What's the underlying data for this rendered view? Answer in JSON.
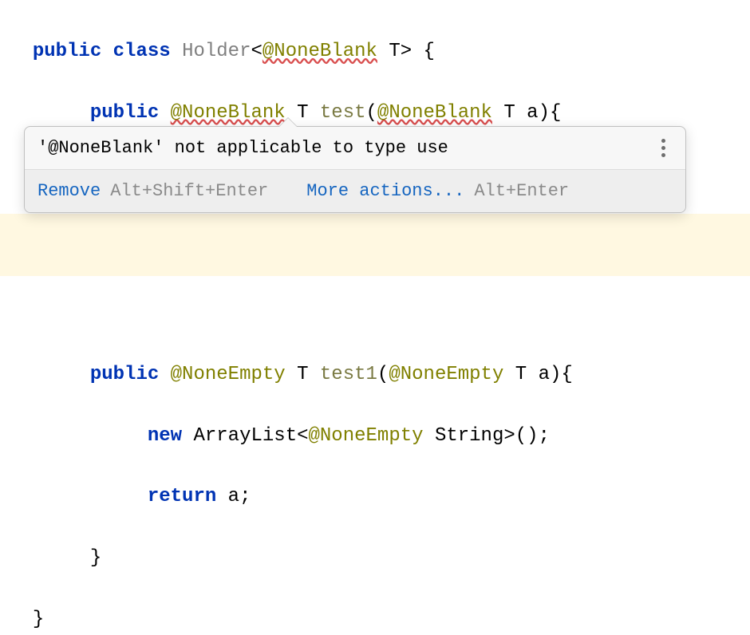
{
  "code": {
    "public": "public",
    "class_kw": "class",
    "class_name": "Holder",
    "anno_none_blank": "@NoneBlank",
    "anno_none_empty": "@NoneEmpty",
    "type_T": "T",
    "type_String": "String",
    "method_test": "test",
    "method_test1": "test1",
    "new_kw": "new",
    "arraylist": "ArrayList",
    "return_kw": "return",
    "var_a": "a",
    "lt": "<",
    "gt": ">",
    "open_brace": " {",
    "close_brace": "}",
    "paren_open": "(",
    "paren_close_brace": "){",
    "paren_close_semi": ">();",
    "semi": ";",
    "space": " ",
    "indent1": "     ",
    "indent2": "          ",
    "indent1b": "     "
  },
  "tooltip": {
    "message": "'@NoneBlank' not applicable to type use",
    "remove": "Remove",
    "remove_shortcut": "Alt+Shift+Enter",
    "more_actions": "More actions...",
    "more_shortcut": "Alt+Enter"
  }
}
